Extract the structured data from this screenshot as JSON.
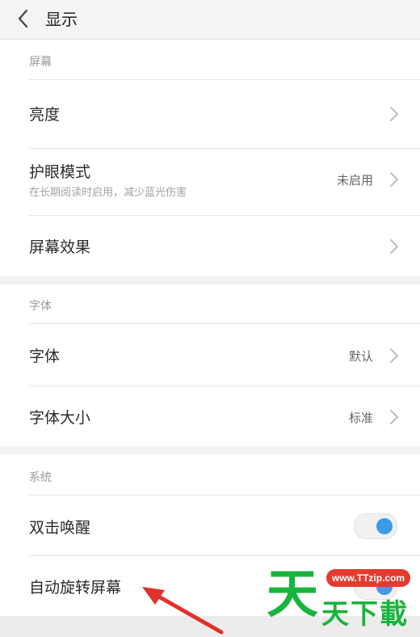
{
  "header": {
    "title": "显示"
  },
  "sections": {
    "screen": {
      "header": "屏幕",
      "brightness": {
        "label": "亮度"
      },
      "eye_protection": {
        "label": "护眼模式",
        "subtitle": "在长期阅读时启用，减少蓝光伤害",
        "value": "未启用"
      },
      "screen_effect": {
        "label": "屏幕效果"
      }
    },
    "font": {
      "header": "字体",
      "font": {
        "label": "字体",
        "value": "默认"
      },
      "font_size": {
        "label": "字体大小",
        "value": "标准"
      }
    },
    "system": {
      "header": "系统",
      "double_tap_wake": {
        "label": "双击唤醒",
        "enabled": true
      },
      "auto_rotate": {
        "label": "自动旋转屏幕",
        "enabled": true
      }
    }
  },
  "colors": {
    "accent": "#3d9ce8",
    "watermark_green": "#18b43c",
    "watermark_red": "#e53a2e",
    "arrow": "#e0312b"
  },
  "watermark": {
    "site": "www.TTzip.com",
    "big_char": "天",
    "text": "天下載"
  }
}
